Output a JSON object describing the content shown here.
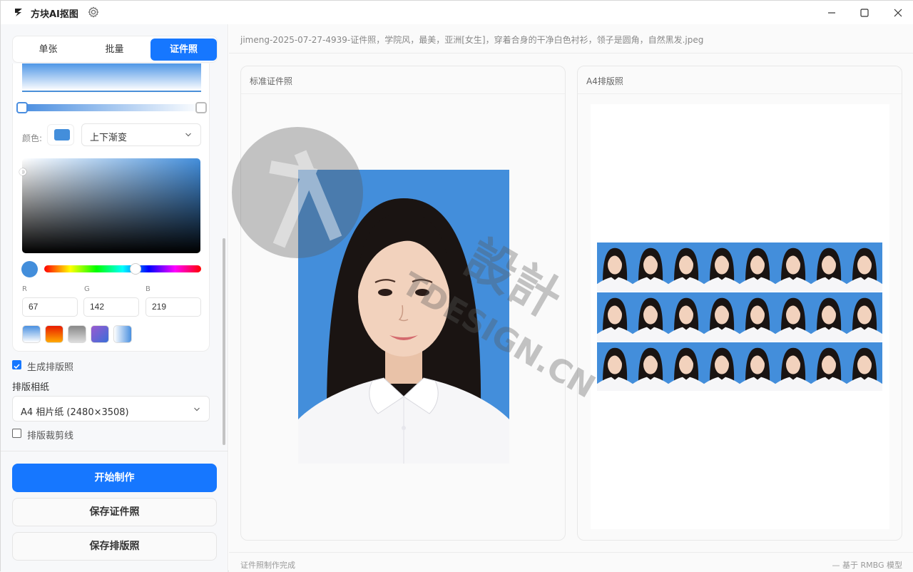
{
  "app": {
    "title": "方块AI抠图",
    "icons": {
      "logo": "bolt-logo-icon",
      "settings": "gear-icon",
      "minimize": "minimize-icon",
      "maximize": "maximize-icon",
      "close": "close-icon"
    }
  },
  "sidebar": {
    "tabs": [
      {
        "label": "单张",
        "active": false
      },
      {
        "label": "批量",
        "active": false
      },
      {
        "label": "证件照",
        "active": true
      }
    ],
    "background": {
      "color_label": "颜色:",
      "current_color": "#438edb",
      "mode_value": "上下渐变",
      "rgb": {
        "r_label": "R",
        "r_value": "67",
        "g_label": "G",
        "g_value": "142",
        "b_label": "B",
        "b_value": "219"
      },
      "presets": [
        "blue-white-gradient",
        "red-orange-gradient",
        "gray-gradient",
        "purple-blue-gradient",
        "light-blue-white-gradient"
      ]
    },
    "layout_checkbox": {
      "label": "生成排版照",
      "checked": true
    },
    "paper_label": "排版相纸",
    "paper_value": "A4 相片纸 (2480×3508)",
    "cutline_checkbox": {
      "label": "排版裁剪线",
      "checked": false
    },
    "buttons": {
      "start": "开始制作",
      "save_id": "保存证件照",
      "save_layout": "保存排版照"
    }
  },
  "main": {
    "filename": "jimeng-2025-07-27-4939-证件照，学院风，最美，亚洲[女生]，穿着合身的干净白色衬衫，领子是圆角，自然黑发.jpeg",
    "cards": {
      "standard_title": "标准证件照",
      "a4_title": "A4排版照"
    },
    "a4_layout": {
      "rows": 3,
      "cols": 8
    }
  },
  "statusbar": {
    "left": "证件照制作完成",
    "right": "—  基于 RMBG 模型"
  },
  "colors": {
    "accent": "#1677ff",
    "photo_background": "#438edb"
  }
}
